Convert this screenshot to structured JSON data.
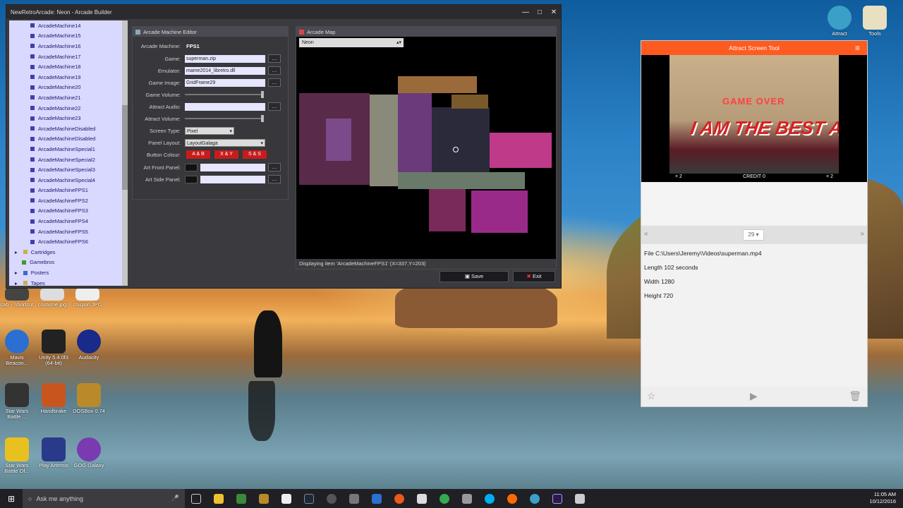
{
  "builder": {
    "title": "NewRetroArcade: Neon - Arcade Builder",
    "window_controls": [
      "—",
      "□",
      "✕"
    ],
    "tree_items": [
      "ArcadeMachine14",
      "ArcadeMachine15",
      "ArcadeMachine16",
      "ArcadeMachine17",
      "ArcadeMachine18",
      "ArcadeMachine19",
      "ArcadeMachine20",
      "ArcadeMachine21",
      "ArcadeMachine22",
      "ArcadeMachine23",
      "ArcadeMachineDisabled",
      "ArcadeMachineDisabled",
      "ArcadeMachineSpecial1",
      "ArcadeMachineSpecial2",
      "ArcadeMachineSpecial3",
      "ArcadeMachineSpecial4",
      "ArcadeMachineFPS1",
      "ArcadeMachineFPS2",
      "ArcadeMachineFPS3",
      "ArcadeMachineFPS4",
      "ArcadeMachineFPS5",
      "ArcadeMachineFPS6"
    ],
    "tree_groups": [
      "Cartridges",
      "Gamebros",
      "Posters",
      "Tapes"
    ],
    "editor": {
      "title": "Arcade Machine Editor",
      "machine_label": "Arcade Machine:",
      "machine_value": "FPS1",
      "game_label": "Game:",
      "game_value": "superman.zip",
      "emulator_label": "Emulator:",
      "emulator_value": "mame2014_libretro.dll",
      "image_label": "Game Image:",
      "image_value": "GridFrame29",
      "game_volume_label": "Game Volume:",
      "attract_audio_label": "Attract Audio:",
      "attract_volume_label": "Attract Volume:",
      "screen_type_label": "Screen Type:",
      "screen_type_value": "Pixel",
      "panel_layout_label": "Panel Layout:",
      "panel_layout_value": "LayoutGalaga",
      "button_colour_label": "Button Colour:",
      "colour_buttons": [
        "A & B",
        "X & Y",
        "S & S"
      ],
      "art_front_label": "Art Front Panel:",
      "art_side_label": "Art Side Panel:",
      "browse": "..."
    },
    "map": {
      "title": "Arcade Map",
      "selected": "Neon",
      "status": "Displaying item 'ArcadeMachineFPS1' (X=337,Y=203)"
    },
    "save_label": "Save",
    "exit_label": "Exit"
  },
  "attract": {
    "title": "Attract Screen Tool",
    "game_over": "GAME OVER",
    "banner": "I AM THE BEST ARTIS",
    "hud_left": "= 2",
    "hud_credit": "CREDIT  0",
    "hud_right": "= 2",
    "page": "29 ▾",
    "prev": "«",
    "next": "»",
    "file": "File C:\\Users\\Jeremy\\Videos\\superman.mp4",
    "length": "Length 102 seconds",
    "width": "Width 1280",
    "height": "Height 720"
  },
  "desktop": {
    "icons": [
      {
        "label": "Attract",
        "color": "#3aa0c8"
      },
      {
        "label": "Tools",
        "color": "#e8e0c0"
      },
      {
        "label": "cab - Shortcut",
        "color": "#444"
      },
      {
        "label": "costume.jpg",
        "color": "#ddd"
      },
      {
        "label": "coupon.JPG",
        "color": "#eee"
      },
      {
        "label": "Mavis Beacon...",
        "color": "#2b6fd1"
      },
      {
        "label": "Unity 5.4.0f3 (64-bit)",
        "color": "#222"
      },
      {
        "label": "Audacity",
        "color": "#1a2a8a"
      },
      {
        "label": "Star Wars Battle ...",
        "color": "#333"
      },
      {
        "label": "Handbrake",
        "color": "#c8551e"
      },
      {
        "label": "DOSBox 0.74",
        "color": "#b88a2a"
      },
      {
        "label": "Star Wars Battle Of...",
        "color": "#e8c020"
      },
      {
        "label": "Play Artemis",
        "color": "#2a3a8a"
      },
      {
        "label": "GOG Galaxy",
        "color": "#7a3ab0"
      }
    ]
  },
  "taskbar": {
    "search_placeholder": "Ask me anything",
    "time": "11:05 AM",
    "date": "10/12/2016",
    "apps": [
      "#2b88d8",
      "#f0c030",
      "#3a8a3a",
      "#b88a2a",
      "#888",
      "#1b2838",
      "#555",
      "#666",
      "#2b6fd1",
      "#e8591a",
      "#ddd",
      "#34a853",
      "#777",
      "#00aff0",
      "#ff6a00",
      "#3aa0c8",
      "#9a3ab0",
      "#ccc"
    ]
  }
}
